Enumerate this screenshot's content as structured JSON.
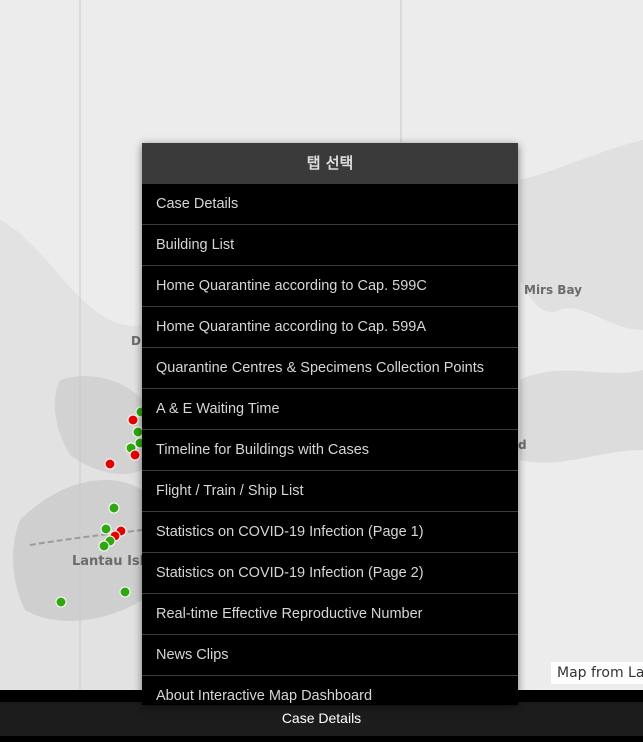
{
  "map": {
    "labels": {
      "mirs_bay": "Mirs Bay",
      "lantau": "Lantau Isl",
      "partial_d": "D",
      "partial_d2": "d"
    },
    "attribution": "Map from La",
    "marker_colors": {
      "red": "#e60000",
      "green": "#2ea80e"
    }
  },
  "tab_menu": {
    "title": "탭 선택",
    "items": [
      "Case Details",
      "Building List",
      "Home Quarantine according to Cap. 599C",
      "Home Quarantine according to Cap. 599A",
      "Quarantine Centres & Specimens Collection Points",
      "A & E Waiting Time",
      "Timeline for Buildings with Cases",
      "Flight / Train / Ship List",
      "Statistics on COVID-19 Infection (Page 1)",
      "Statistics on COVID-19 Infection (Page 2)",
      "Real-time Effective Reproductive Number",
      "News Clips",
      "About Interactive Map Dashboard"
    ]
  },
  "bottom_bar": {
    "active_tab": "Case Details"
  }
}
